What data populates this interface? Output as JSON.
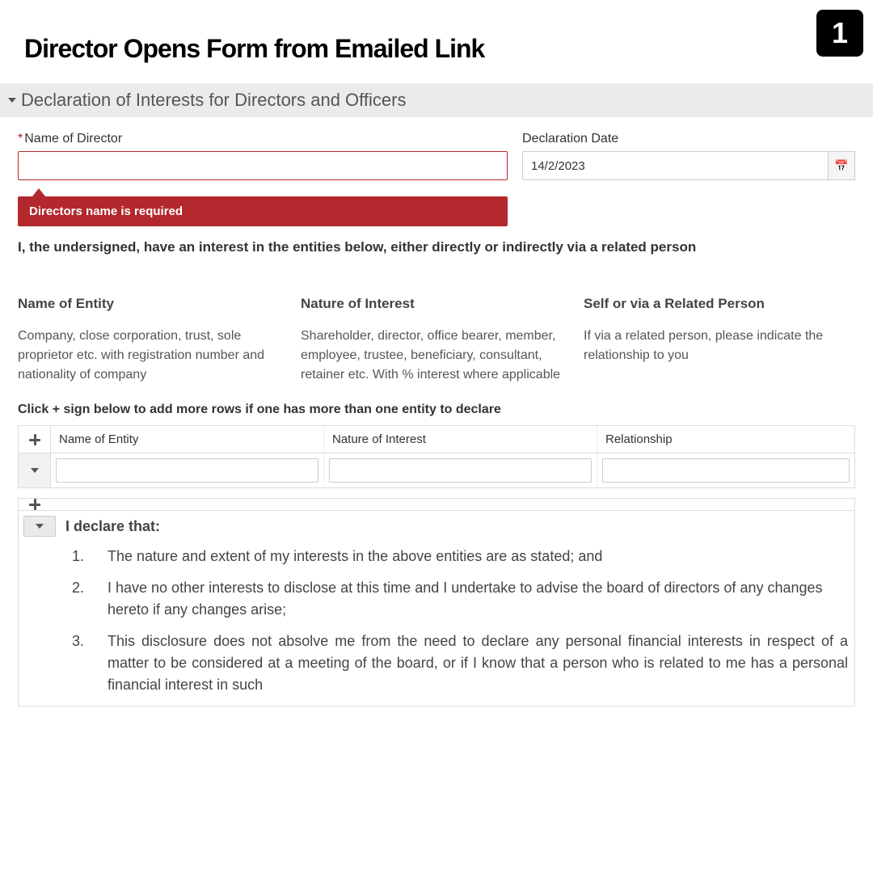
{
  "step_badge": "1",
  "page_title": "Director Opens Form from Emailed Link",
  "section_title": "Declaration of Interests for Directors and Officers",
  "fields": {
    "director_label": "Name of Director",
    "director_value": "",
    "director_error": "Directors name is required",
    "date_label": "Declaration Date",
    "date_value": "14/2/2023"
  },
  "statement": "I, the undersigned, have an interest in the entities below, either directly or indirectly via a related person",
  "columns": [
    {
      "header": "Name of Entity",
      "desc": "Company, close corporation, trust, sole proprietor etc. with registration number and nationality of company"
    },
    {
      "header": "Nature of Interest",
      "desc": "Shareholder, director, office bearer, member, employee, trustee, beneficiary, consultant, retainer etc. With % interest where applicable"
    },
    {
      "header": "Self or via a Related Person",
      "desc": "If via a related person, please indicate the relationship to you"
    }
  ],
  "hint": "Click + sign below to add more rows if one has more than one entity to declare",
  "grid_headers": [
    "Name of Entity",
    "Nature of Interest",
    "Relationship"
  ],
  "grid_row": {
    "entity": "",
    "nature": "",
    "relationship": ""
  },
  "declaration": {
    "title": "I declare that:",
    "items": [
      "The nature and extent of my interests in the above entities are as stated; and",
      "I have no other interests to disclose at this time and I undertake to advise the board of directors of any changes hereto if any changes arise;",
      "This disclosure does not absolve me from the need to declare any personal financial interests in respect of a matter to be considered at a meeting of the board, or if I know that a person who is related to me has a personal financial interest in such"
    ]
  }
}
